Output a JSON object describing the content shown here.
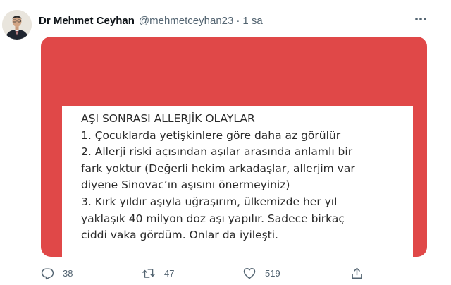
{
  "tweet": {
    "author": {
      "display_name": "Dr Mehmet Ceyhan",
      "handle": "@mehmetceyhan23",
      "separator": "·",
      "time": "1 sa",
      "avatar_icon": "profile-photo"
    },
    "more_icon": "more-horizontal-icon",
    "media": {
      "background_color": "#e04848",
      "lines": [
        "AŞI SONRASI ALLERJİK OLAYLAR",
        "1. Çocuklarda yetişkinlere göre daha az görülür",
        "2. Allerji riski açısından aşılar arasında anlamlı bir",
        "fark yoktur (Değerli hekim arkadaşlar, allerjim var",
        "diyene Sinovac’ın aşısını önermeyiniz)",
        "3. Kırk yıldır aşıyla uğraşırım, ülkemizde her yıl",
        "yaklaşık 40 milyon doz aşı yapılır. Sadece birkaç",
        "ciddi vaka gördüm. Onlar da iyileşti."
      ]
    },
    "actions": {
      "reply_count": "38",
      "retweet_count": "47",
      "like_count": "519",
      "reply_icon": "reply-icon",
      "retweet_icon": "retweet-icon",
      "like_icon": "heart-icon",
      "share_icon": "share-icon"
    }
  }
}
